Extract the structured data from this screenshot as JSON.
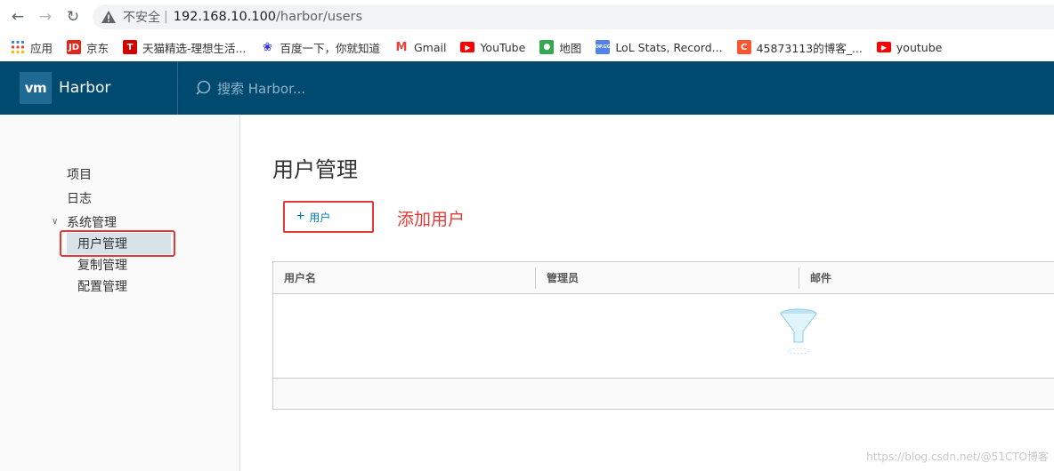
{
  "browser": {
    "insecure_label": "不安全",
    "separator": "|",
    "url_host": "192.168.10.100",
    "url_path": "/harbor/users"
  },
  "bookmarks": [
    {
      "label": "应用",
      "icon": "apps-grid-icon",
      "color": "#4285f4"
    },
    {
      "label": "京东",
      "icon": "jd-icon",
      "color": "#e1251b"
    },
    {
      "label": "天猫精选-理想生活...",
      "icon": "tmall-icon",
      "color": "#d50000"
    },
    {
      "label": "百度一下，你就知道",
      "icon": "baidu-icon",
      "color": "#2932e1"
    },
    {
      "label": "Gmail",
      "icon": "gmail-icon",
      "color": "#ea4335"
    },
    {
      "label": "YouTube",
      "icon": "youtube-icon",
      "color": "#ff0000"
    },
    {
      "label": "地图",
      "icon": "maps-icon",
      "color": "#34a853"
    },
    {
      "label": "LoL Stats, Record...",
      "icon": "opgg-icon",
      "color": "#5383e8"
    },
    {
      "label": "45873113的博客_...",
      "icon": "csdn-icon",
      "color": "#fc5531"
    },
    {
      "label": "youtube",
      "icon": "youtube-icon",
      "color": "#ff0000"
    }
  ],
  "header": {
    "logo": "vm",
    "brand": "Harbor",
    "search_placeholder": "搜索 Harbor..."
  },
  "sidebar": {
    "items": [
      {
        "label": "项目"
      },
      {
        "label": "日志"
      },
      {
        "label": "系统管理"
      }
    ],
    "sub_items": [
      {
        "label": "用户管理",
        "active": true
      },
      {
        "label": "复制管理",
        "active": false
      },
      {
        "label": "配置管理",
        "active": false
      }
    ]
  },
  "main": {
    "title": "用户管理",
    "add_button": "用户",
    "annotation": "添加用户",
    "columns": [
      "用户名",
      "管理员",
      "邮件"
    ]
  },
  "watermark": "https://blog.csdn.net/@51CTO博客",
  "colors": {
    "header_bg": "#004a70",
    "accent": "#0079b8",
    "annotation": "#e53935"
  }
}
